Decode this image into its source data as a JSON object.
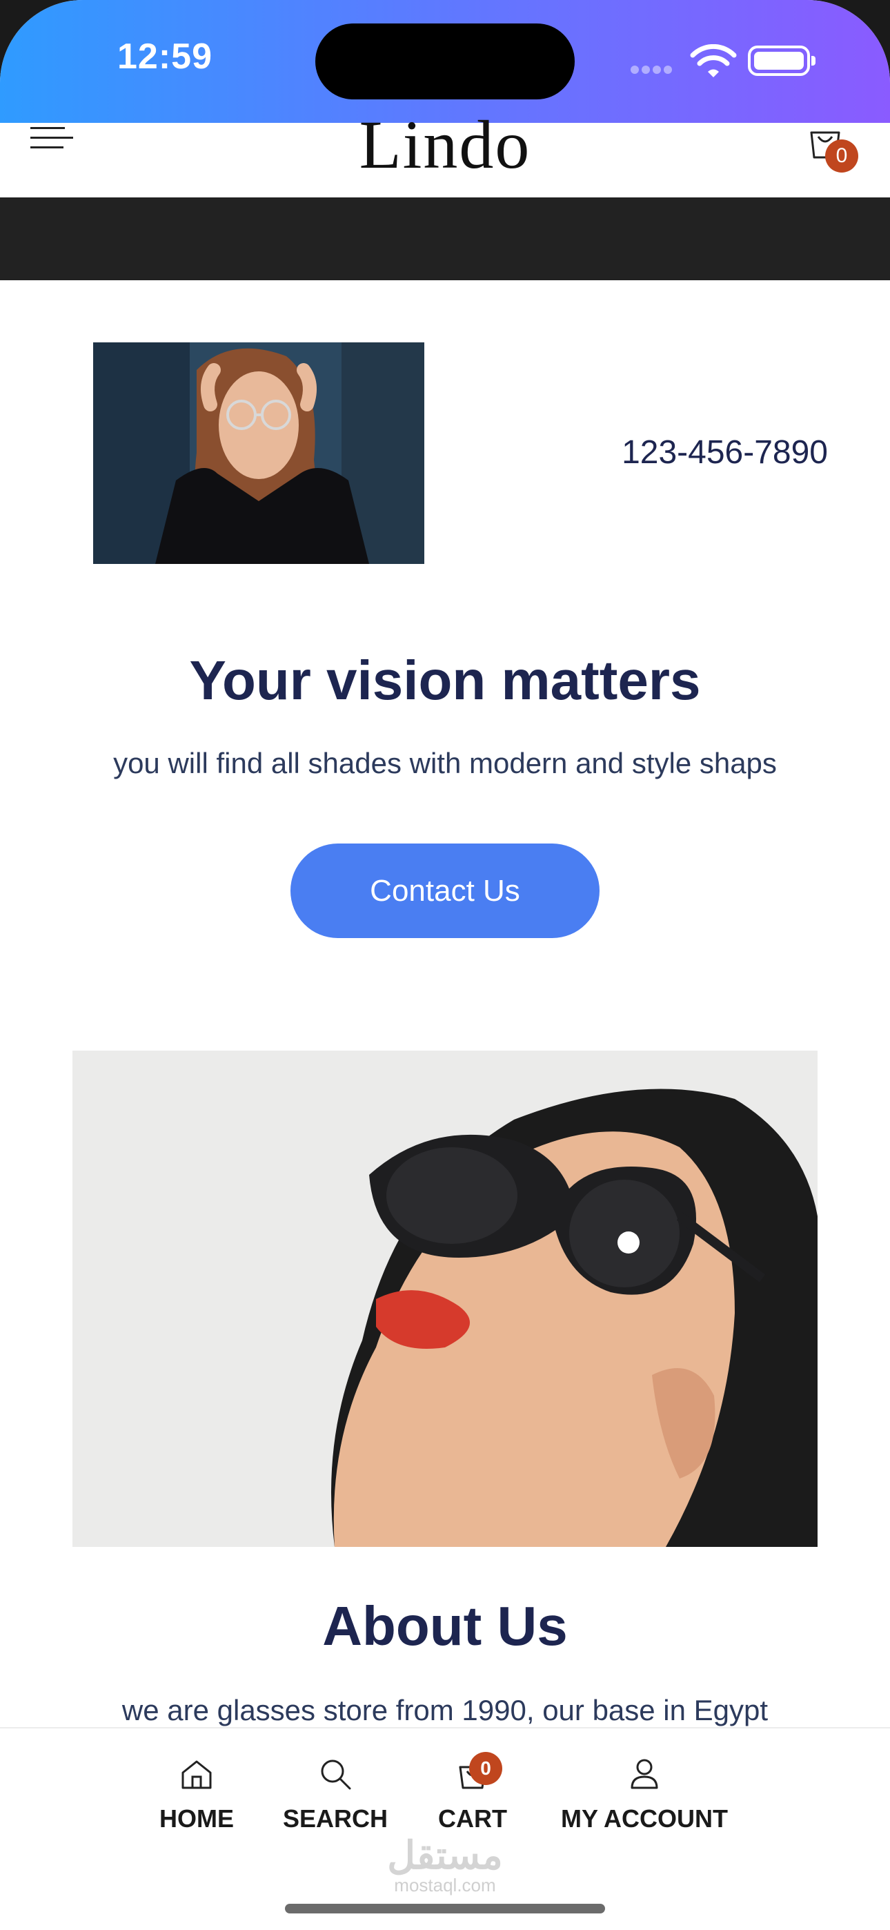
{
  "status_bar": {
    "time": "12:59"
  },
  "header": {
    "logo": "Lindo",
    "cart_count": "0"
  },
  "hero": {
    "phone": "123-456-7890",
    "headline": "Your vision matters",
    "subline": "you will find all shades with modern and style shaps",
    "contact_button": "Contact Us"
  },
  "about": {
    "title": "About Us",
    "text": "we are glasses store from 1990, our base in Egypt"
  },
  "bottom_nav": {
    "items": [
      {
        "label": "HOME",
        "icon": "home-icon"
      },
      {
        "label": "SEARCH",
        "icon": "search-icon"
      },
      {
        "label": "CART",
        "icon": "shopping-bag-icon",
        "badge": "0"
      },
      {
        "label": "MY ACCOUNT",
        "icon": "user-icon"
      }
    ]
  },
  "watermark": {
    "arabic": "مستقل",
    "latin": "mostaql.com"
  },
  "colors": {
    "primary_text": "#1d2550",
    "button": "#4a7ef2",
    "badge": "#c0461e",
    "dark_band": "#222222",
    "status_gradient_start": "#2f9bff",
    "status_gradient_end": "#8a5bff"
  }
}
